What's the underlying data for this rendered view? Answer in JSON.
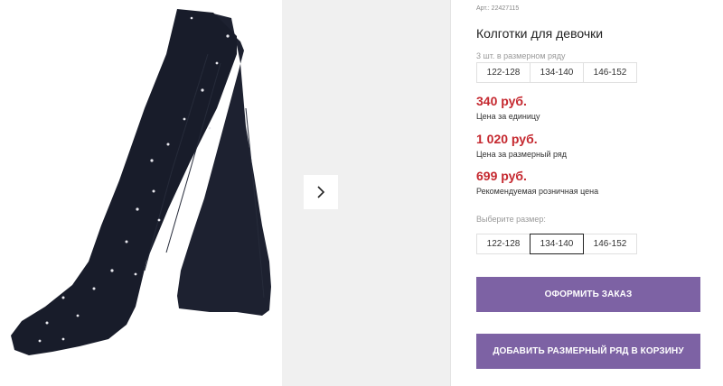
{
  "product": {
    "sku": "Арт.: 22427115",
    "title": "Колготки для девочки"
  },
  "pack": {
    "label": "3 шт. в размерном ряду",
    "sizes": [
      "122-128",
      "134-140",
      "146-152"
    ]
  },
  "prices": [
    {
      "value": "340 руб.",
      "note": "Цена за единицу"
    },
    {
      "value": "1 020 руб.",
      "note": "Цена за размерный ряд"
    },
    {
      "value": "699 руб.",
      "note": "Рекомендуемая розничная цена"
    }
  ],
  "size_select": {
    "label": "Выберите размер:",
    "options": [
      "122-128",
      "134-140",
      "146-152"
    ],
    "selected": "134-140"
  },
  "buttons": {
    "order": "ОФОРМИТЬ ЗАКАЗ",
    "add_to_cart": "ДОБАВИТЬ РАЗМЕРНЫЙ РЯД В КОРЗИНУ"
  },
  "colors": {
    "price": "#c5282f",
    "button": "#7d62a4",
    "gallery_bg": "#f0f0f0"
  },
  "icons": {
    "next": "chevron-right-icon"
  }
}
